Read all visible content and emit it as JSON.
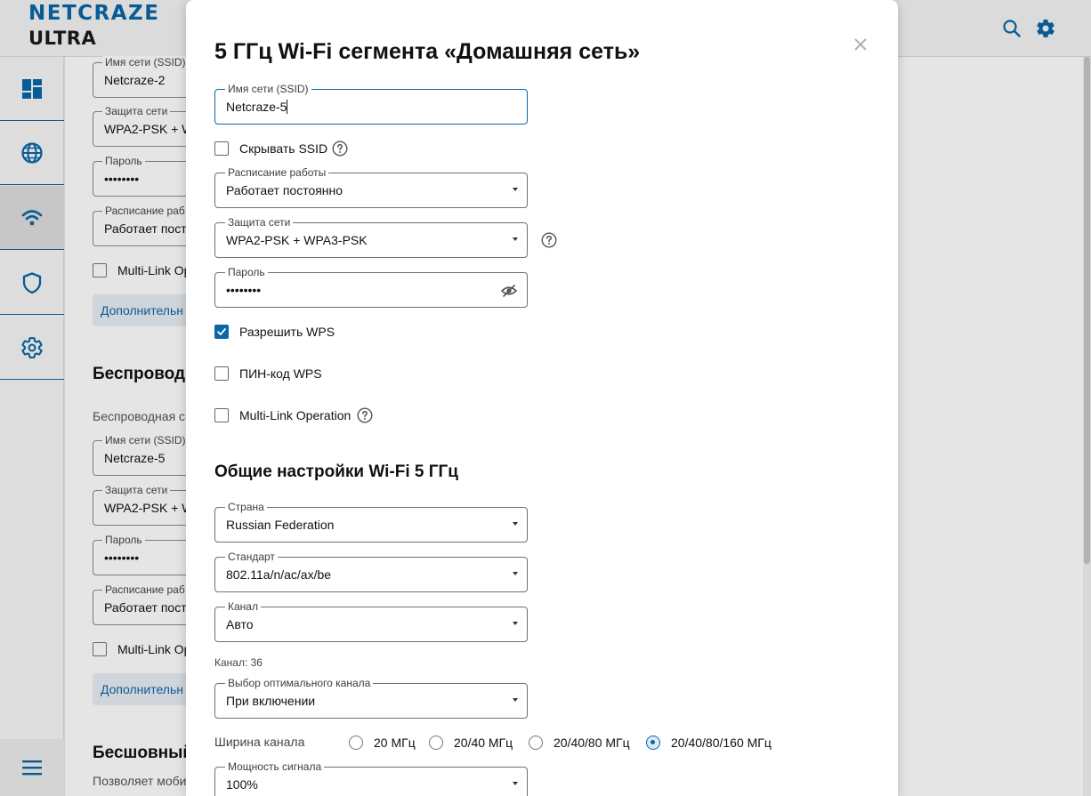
{
  "header": {
    "logo_line1": "NETCRAZE",
    "logo_line2": "ULTRA",
    "search_icon": "search-icon",
    "settings_icon": "gear-icon"
  },
  "sidebar": {
    "items": [
      {
        "name": "dashboard",
        "icon": "dashboard-icon"
      },
      {
        "name": "internet",
        "icon": "globe-icon"
      },
      {
        "name": "wifi",
        "icon": "wifi-icon",
        "active": true
      },
      {
        "name": "security",
        "icon": "shield-icon"
      },
      {
        "name": "settings",
        "icon": "gear-icon"
      }
    ],
    "menu_icon": "hamburger-icon"
  },
  "background": {
    "seg1": {
      "ssid_label": "Имя сети (SSID)",
      "ssid_value": "Netcraze-2",
      "security_label": "Защита сети",
      "security_value": "WPA2-PSK + W",
      "password_label": "Пароль",
      "password_value": "••••••••",
      "schedule_label": "Расписание раб",
      "schedule_value": "Работает пост",
      "mlo_label": "Multi-Link Op",
      "more_button": "Дополнительн"
    },
    "section2_title": "Беспроводн",
    "section2_desc": "Беспроводная с",
    "seg2": {
      "ssid_label": "Имя сети (SSID)",
      "ssid_value": "Netcraze-5",
      "security_label": "Защита сети",
      "security_value": "WPA2-PSK + W",
      "password_label": "Пароль",
      "password_value": "••••••••",
      "schedule_label": "Расписание раб",
      "schedule_value": "Работает пост",
      "mlo_label": "Multi-Link Op",
      "more_button": "Дополнительн"
    },
    "section3_title": "Бесшовный",
    "section3_desc": "Позволяет моби"
  },
  "modal": {
    "title": "5 ГГц Wi-Fi сегмента «Домашняя сеть»",
    "ssid": {
      "label": "Имя сети (SSID)",
      "value": "Netcraze-5"
    },
    "hide_ssid": {
      "label": "Скрывать SSID",
      "checked": false
    },
    "schedule": {
      "label": "Расписание работы",
      "value": "Работает постоянно"
    },
    "security": {
      "label": "Защита сети",
      "value": "WPA2-PSK + WPA3-PSK"
    },
    "password": {
      "label": "Пароль",
      "value": "••••••••"
    },
    "wps": {
      "label": "Разрешить WPS",
      "checked": true
    },
    "wps_pin": {
      "label": "ПИН-код WPS",
      "checked": false
    },
    "mlo": {
      "label": "Multi-Link Operation",
      "checked": false
    },
    "general_title": "Общие настройки Wi-Fi 5 ГГц",
    "country": {
      "label": "Страна",
      "value": "Russian Federation"
    },
    "standard": {
      "label": "Стандарт",
      "value": "802.11a/n/ac/ax/be"
    },
    "channel": {
      "label": "Канал",
      "value": "Авто"
    },
    "channel_info": "Канал: 36",
    "optimal_channel": {
      "label": "Выбор оптимального канала",
      "value": "При включении"
    },
    "bandwidth": {
      "label": "Ширина канала",
      "options": [
        "20 МГц",
        "20/40 МГц",
        "20/40/80 МГц",
        "20/40/80/160 МГц"
      ],
      "selected": "20/40/80/160 МГц"
    },
    "power": {
      "label": "Мощность сигнала",
      "value": "100%"
    }
  },
  "colors": {
    "accent": "#0a67a6",
    "overlay": "rgba(0,0,0,0.10)"
  }
}
